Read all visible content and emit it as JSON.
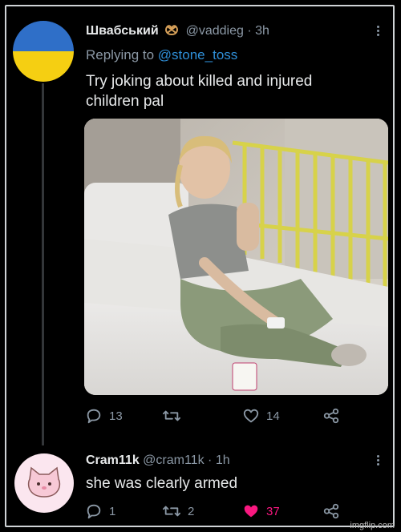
{
  "tweet": {
    "name": "Швабський",
    "handle": "@vaddieg",
    "time": "3h",
    "replying_prefix": "Replying to",
    "replying_mention": "@stone_toss",
    "text_line1": "Try joking about killed and injured",
    "text_line2": "children pal",
    "media_icon": "photo-of-child-on-hospital-bed",
    "actions": {
      "reply_count": "13",
      "retweet_count": "",
      "like_count": "14"
    }
  },
  "reply": {
    "name": "Cram11k",
    "handle": "@cram11k",
    "time": "1h",
    "text": "she was clearly armed",
    "actions": {
      "reply_count": "1",
      "retweet_count": "2",
      "like_count": "37"
    }
  },
  "colors": {
    "like_active": "#f91880",
    "mention": "#2f8fd8",
    "muted": "#8b98a5"
  },
  "watermark": "imgflip.com"
}
